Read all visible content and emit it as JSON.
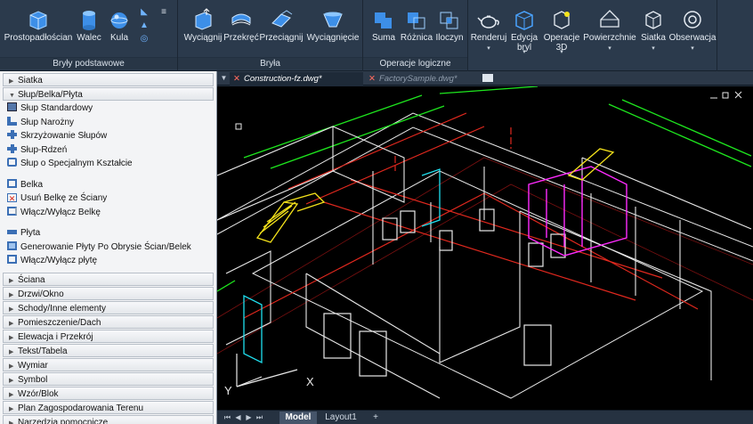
{
  "ribbon": {
    "groups": [
      {
        "title": "Bryły podstawowe",
        "buttons": [
          "Prostopadłościan",
          "Walec",
          "Kula"
        ]
      },
      {
        "title": "Bryła",
        "buttons": [
          "Wyciągnij",
          "Przekręć",
          "Przeciągnij",
          "Wyciągnięcie"
        ]
      },
      {
        "title": "Operacje logiczne",
        "buttons": [
          "Suma",
          "Różnica",
          "Iloczyn"
        ]
      },
      {
        "title": "",
        "buttons": [
          "Renderuj",
          "Edycja bryl",
          "Operacje 3D",
          "Powierzchnie",
          "Siatka",
          "Obserwacja"
        ]
      }
    ],
    "split_arrow": "▾"
  },
  "left_panel": {
    "cat_siatka": "Siatka",
    "cat_slup": "Słup/Belka/Płyta",
    "slup_items": [
      "Słup Standardowy",
      "Słup Narożny",
      "Skrzyżowanie Słupów",
      "Słup-Rdzeń",
      "Słup o Specjalnym Kształcie"
    ],
    "belka_items": [
      "Belka",
      "Usuń Belkę ze Ściany",
      "Włącz/Wyłącz Belkę"
    ],
    "plyta_items": [
      "Płyta",
      "Generowanie Płyty Po Obrysie Ścian/Belek",
      "Włącz/Wyłącz płytę"
    ],
    "categories": [
      "Ściana",
      "Drzwi/Okno",
      "Schody/Inne elementy",
      "Pomieszczenie/Dach",
      "Elewacja i Przekrój",
      "Tekst/Tabela",
      "Wymiar",
      "Symbol",
      "Wzór/Blok",
      "Plan Zagospodarowania Terenu",
      "Narzędzia pomocnicze",
      "Układ/Eksport"
    ]
  },
  "documents": {
    "active_tab": "Construction-fz.dwg*",
    "inactive_tab": "FactorySample.dwg*",
    "close_glyph": "✕"
  },
  "viewport": {
    "axis_x": "X",
    "axis_y": "Y"
  },
  "layout_tabs": {
    "model": "Model",
    "layout1": "Layout1",
    "add": "+"
  },
  "colors": {
    "ribbon_bg": "#2b3a4c",
    "accent_blue": "#4aa3ff",
    "viewport_bg": "#000000",
    "cad_white": "#e8e8e8",
    "cad_red": "#e0281e",
    "cad_green": "#1ee61e",
    "cad_magenta": "#ff2bff",
    "cad_yellow": "#f5e31b",
    "cad_cyan": "#20e0f0"
  }
}
